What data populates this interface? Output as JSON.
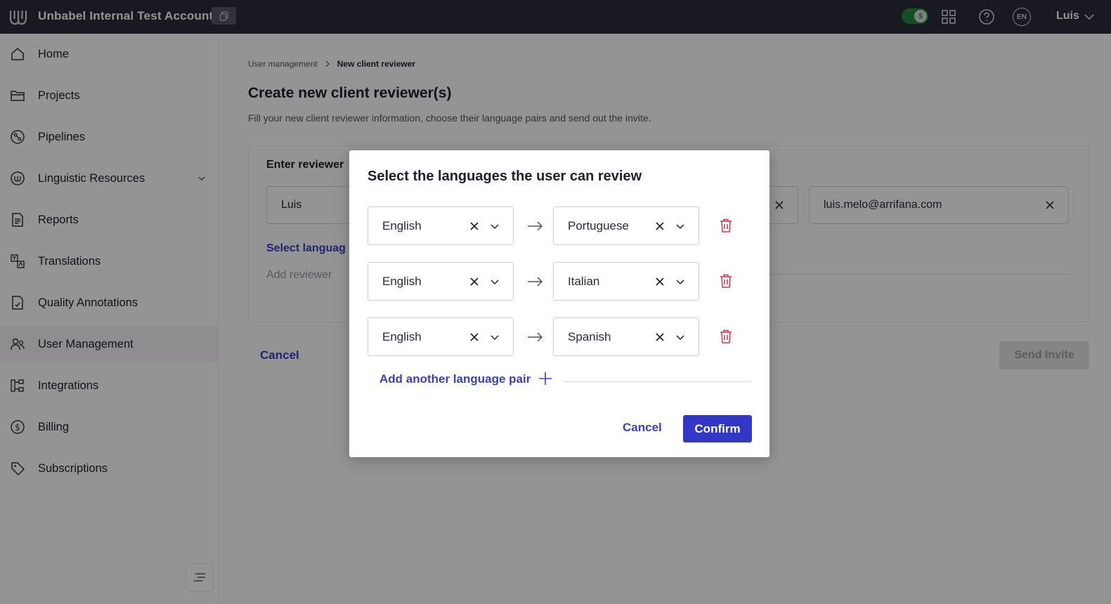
{
  "topbar": {
    "account_name": "Unbabel Internal Test Account",
    "language_badge": "EN",
    "user_name": "Luis",
    "toggle_state": "on",
    "accent_color": "#2b2e3a"
  },
  "sidebar": {
    "items": [
      {
        "label": "Home",
        "icon": "home-icon"
      },
      {
        "label": "Projects",
        "icon": "folder-icon"
      },
      {
        "label": "Pipelines",
        "icon": "pipeline-icon"
      },
      {
        "label": "Linguistic Resources",
        "icon": "resources-icon"
      },
      {
        "label": "Reports",
        "icon": "report-icon"
      },
      {
        "label": "Translations",
        "icon": "translations-icon"
      },
      {
        "label": "Quality Annotations",
        "icon": "annotation-icon"
      },
      {
        "label": "User Management",
        "icon": "users-icon"
      },
      {
        "label": "Integrations",
        "icon": "integrations-icon"
      },
      {
        "label": "Billing",
        "icon": "billing-icon"
      },
      {
        "label": "Subscriptions",
        "icon": "tag-icon"
      }
    ],
    "active_item": "User Management"
  },
  "main": {
    "breadcrumb": [
      "User management",
      "New client reviewer"
    ],
    "title": "Create new client reviewer(s)",
    "subtitle": "Fill your new client reviewer information, choose their language pairs and send out the invite.",
    "card": {
      "title": "Enter reviewer",
      "first_name_value": "Luis",
      "email_value": "luis.melo@arrifana.com",
      "select_languages_link": "Select languag",
      "add_reviewer_link": "Add reviewer"
    },
    "cancel_label": "Cancel",
    "send_invite_label": "Send Invite"
  },
  "modal": {
    "title": "Select the languages the user can review",
    "pairs": [
      {
        "source": "English",
        "target": "Portuguese"
      },
      {
        "source": "English",
        "target": "Italian"
      },
      {
        "source": "English",
        "target": "Spanish"
      }
    ],
    "add_pair_label": "Add another language pair",
    "cancel_label": "Cancel",
    "confirm_label": "Confirm",
    "primary_color": "#3337c8",
    "delete_color": "#d6304a"
  }
}
